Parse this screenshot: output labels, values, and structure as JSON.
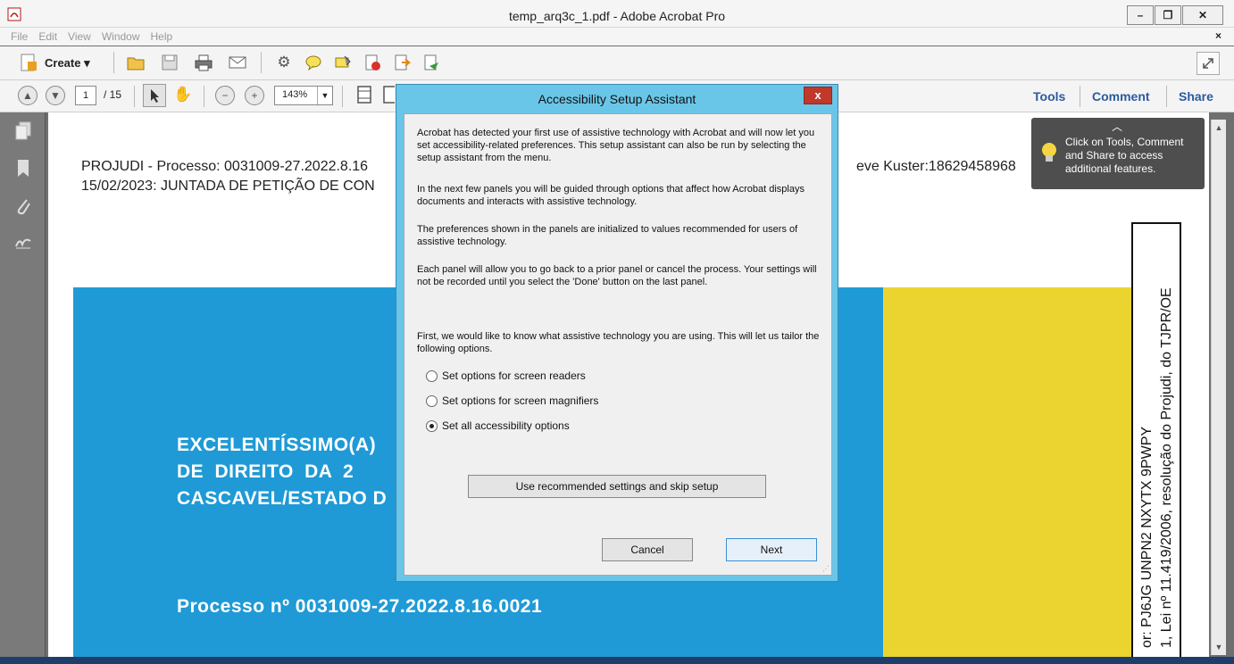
{
  "window": {
    "title": "temp_arq3c_1.pdf - Adobe Acrobat Pro",
    "minimize": "–",
    "maximize": "❐",
    "close": "✕"
  },
  "menu": {
    "items": [
      "File",
      "Edit",
      "View",
      "Window",
      "Help"
    ],
    "close": "×"
  },
  "toolbar": {
    "create_label": "Create ▾"
  },
  "nav": {
    "page_current": "1",
    "page_total": "/ 15",
    "zoom": "143%"
  },
  "panels": {
    "tools": "Tools",
    "comment": "Comment",
    "share": "Share"
  },
  "tooltip": {
    "text": "Click on Tools, Comment and Share to access additional features."
  },
  "document": {
    "header_line1": "PROJUDI - Processo: 0031009-27.2022.8.16",
    "header_line1_right": "eve Kuster:18629458968",
    "header_line2": "15/02/2023: JUNTADA DE PETIÇÃO DE CON",
    "title_line1": "EXCELENTÍSSIMO(A)",
    "title_line2": "DE  DIREITO  DA  2",
    "title_line3": "CASCAVEL/ESTADO D",
    "process": "Processo nº 0031009-27.2022.8.16.0021",
    "side_line1": "1, Lei nº 11.419/2006, resolução do Projudi, do TJPR/OE",
    "side_line2": "or: PJ6JG UNPN2 NXYTX 9PWPY"
  },
  "dialog": {
    "title": "Accessibility Setup Assistant",
    "close": "x",
    "para1": "Acrobat has detected your first use of assistive technology with Acrobat and will now let you set accessibility-related preferences. This setup assistant can also be run by selecting the setup assistant from the  menu.",
    "para2": "In the next few panels you will be guided through options that affect how Acrobat displays documents and interacts with assistive technology.",
    "para3": "The preferences shown in the panels are initialized to values recommended for users of assistive technology.",
    "para4": "Each panel will allow you to go back to a prior panel or cancel the process. Your settings will not be recorded until you select the 'Done' button on the last panel.",
    "para5": "First, we would like to know what assistive technology you are using. This will let us tailor the following options.",
    "option1": "Set options for screen readers",
    "option2": "Set options for screen magnifiers",
    "option3": "Set all accessibility options",
    "selected_option": 3,
    "skip_button": "Use recommended settings and skip setup",
    "cancel_button": "Cancel",
    "next_button": "Next"
  }
}
